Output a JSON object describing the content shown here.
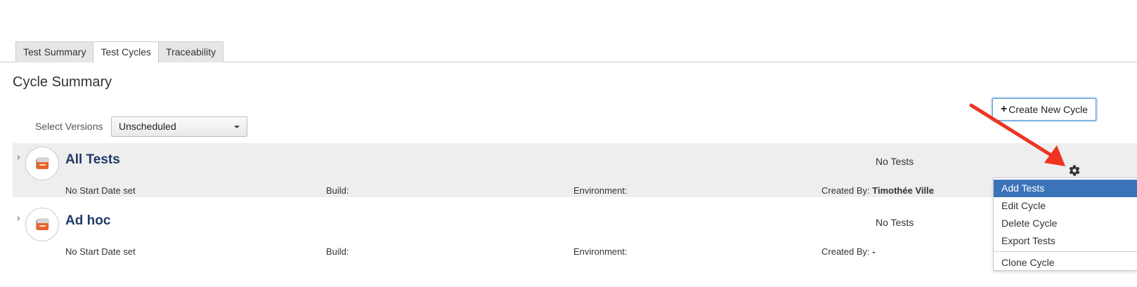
{
  "tabs": [
    {
      "label": "Test Summary",
      "active": false
    },
    {
      "label": "Test Cycles",
      "active": true
    },
    {
      "label": "Traceability",
      "active": false
    }
  ],
  "page_title": "Cycle Summary",
  "create_button": {
    "icon": "plus-icon",
    "label": "Create New Cycle"
  },
  "versions": {
    "label": "Select Versions",
    "selected": "Unscheduled"
  },
  "cycles": [
    {
      "name": "All Tests",
      "status": "No Tests",
      "start_date": "No Start Date set",
      "build_label": "Build:",
      "environment_label": "Environment:",
      "created_by_label": "Created By:",
      "created_by": "Timothée Ville"
    },
    {
      "name": "Ad hoc",
      "status": "No Tests",
      "start_date": "No Start Date set",
      "build_label": "Build:",
      "environment_label": "Environment:",
      "created_by_label": "Created By:",
      "created_by": "-"
    }
  ],
  "menu": {
    "items": [
      "Add Tests",
      "Edit Cycle",
      "Delete Cycle",
      "Export Tests"
    ],
    "extra_item": "Clone Cycle",
    "highlighted": "Add Tests"
  },
  "colors": {
    "cycle_name": "#1f3a68",
    "menu_highlight": "#3b73b9",
    "annotation_arrow": "#ee3322",
    "row_shade": "#eeeeee"
  },
  "icons": {
    "cycle": "cycle-folder-icon",
    "expander": "chevron-right-icon",
    "settings": "gear-icon"
  }
}
